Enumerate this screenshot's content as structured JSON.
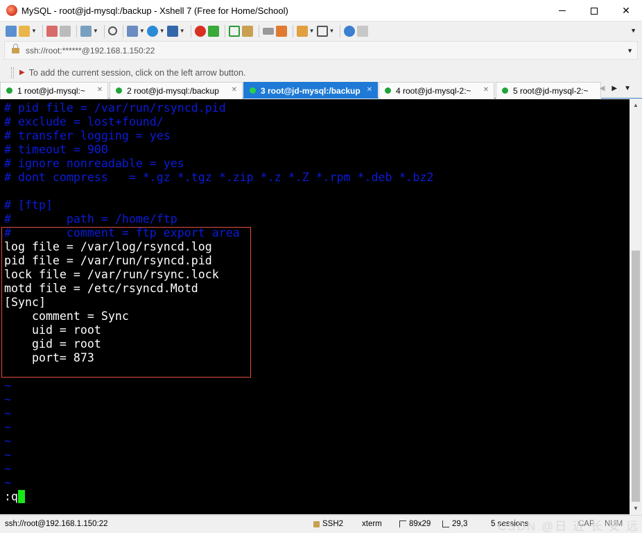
{
  "window": {
    "title": "MySQL - root@jd-mysql:/backup - Xshell 7 (Free for Home/School)"
  },
  "address": {
    "value": "ssh://root:******@192.168.1.150:22"
  },
  "hint": {
    "text": "To add the current session, click on the left arrow button."
  },
  "tabs": [
    {
      "label": "1 root@jd-mysql:~",
      "active": false
    },
    {
      "label": "2 root@jd-mysql:/backup",
      "active": false
    },
    {
      "label": "3 root@jd-mysql:/backup",
      "active": true
    },
    {
      "label": "4 root@jd-mysql-2:~",
      "active": false
    },
    {
      "label": "5 root@jd-mysql-2:~",
      "active": false
    }
  ],
  "terminal": {
    "lines": [
      {
        "text": "# pid file = /var/run/rsyncd.pid",
        "kind": "comment"
      },
      {
        "text": "# exclude = lost+found/",
        "kind": "comment"
      },
      {
        "text": "# transfer logging = yes",
        "kind": "comment"
      },
      {
        "text": "# timeout = 900",
        "kind": "comment"
      },
      {
        "text": "# ignore nonreadable = yes",
        "kind": "comment"
      },
      {
        "text": "# dont compress   = *.gz *.tgz *.zip *.z *.Z *.rpm *.deb *.bz2",
        "kind": "comment"
      },
      {
        "text": "",
        "kind": "normal"
      },
      {
        "text": "# [ftp]",
        "kind": "comment"
      },
      {
        "text": "#        path = /home/ftp",
        "kind": "comment"
      },
      {
        "text": "#        comment = ftp export area",
        "kind": "comment"
      },
      {
        "text": "log file = /var/log/rsyncd.log",
        "kind": "normal"
      },
      {
        "text": "pid file = /var/run/rsyncd.pid",
        "kind": "normal"
      },
      {
        "text": "lock file = /var/run/rsync.lock",
        "kind": "normal"
      },
      {
        "text": "motd file = /etc/rsyncd.Motd",
        "kind": "normal"
      },
      {
        "text": "[Sync]",
        "kind": "normal"
      },
      {
        "text": "    comment = Sync",
        "kind": "normal"
      },
      {
        "text": "    uid = root",
        "kind": "normal"
      },
      {
        "text": "    gid = root",
        "kind": "normal"
      },
      {
        "text": "    port= 873",
        "kind": "normal"
      },
      {
        "text": "",
        "kind": "normal"
      },
      {
        "text": "~",
        "kind": "tilde"
      },
      {
        "text": "~",
        "kind": "tilde"
      },
      {
        "text": "~",
        "kind": "tilde"
      },
      {
        "text": "~",
        "kind": "tilde"
      },
      {
        "text": "~",
        "kind": "tilde"
      },
      {
        "text": "~",
        "kind": "tilde"
      },
      {
        "text": "~",
        "kind": "tilde"
      },
      {
        "text": "~",
        "kind": "tilde"
      }
    ],
    "command": ":q"
  },
  "status": {
    "connection": "ssh://root@192.168.1.150:22",
    "protocol": "SSH2",
    "terminal_type": "xterm",
    "size": "89x29",
    "cursor_pos": "29,3",
    "sessions": "5 sessions",
    "caps": "CAP",
    "num": "NUM"
  },
  "watermark": "CSDN @日 近 长 安 远",
  "colors": {
    "comment": "#0b1cd8",
    "tab_active": "#1e7ad6",
    "highlight_border": "#e05040",
    "cursor": "#18e818"
  }
}
